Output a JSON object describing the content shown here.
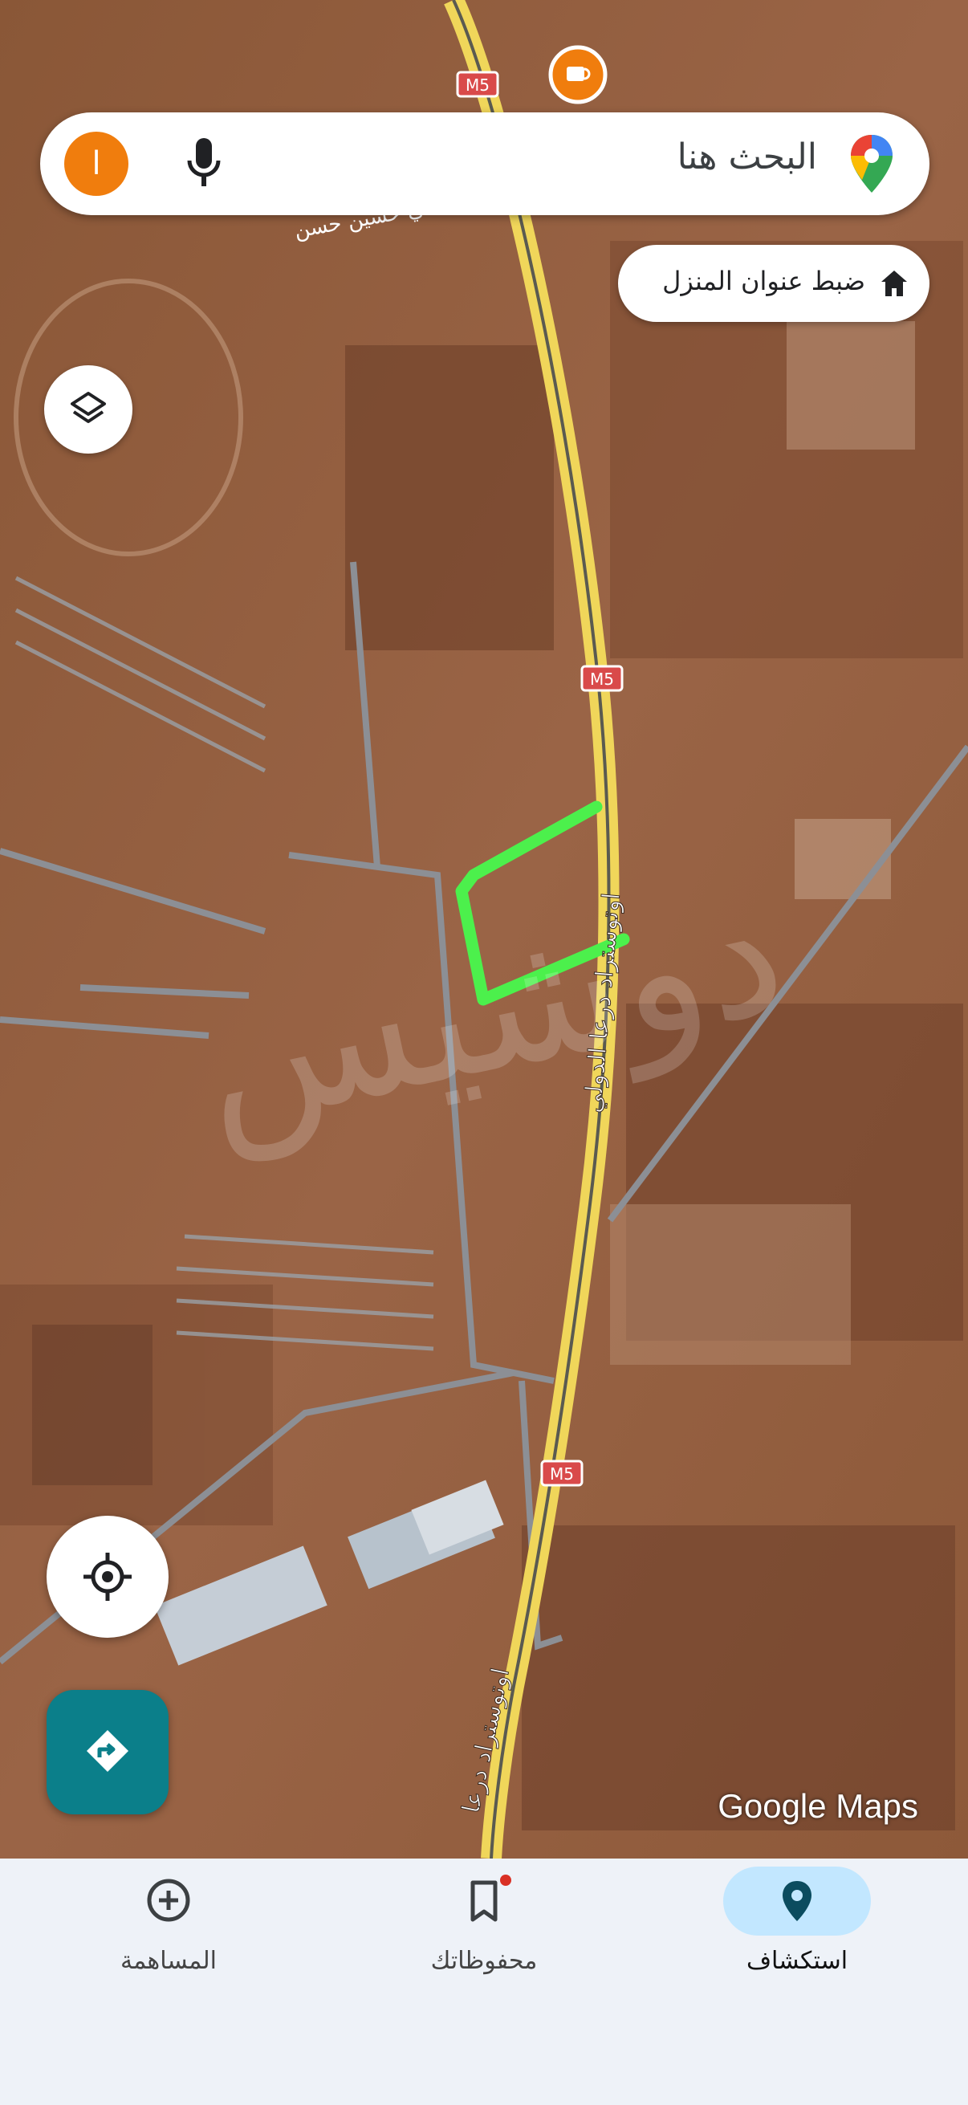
{
  "map": {
    "road_shields": [
      "M5",
      "M5",
      "M5"
    ],
    "road_labels": [
      "اوتوستراد درعا الدولي",
      "اوتوستراد درعا",
      "سي حسين حسن"
    ],
    "watermark_text": "دوشيس",
    "brand": "Google Maps",
    "highlight_color": "#4cf04c"
  },
  "search": {
    "placeholder": "البحث هنا",
    "avatar_letter": "ا",
    "avatar_color": "#f07d0d"
  },
  "chips": {
    "home": "ضبط عنوان المنزل"
  },
  "buttons": {
    "layers_icon": "layers-icon",
    "locate_icon": "my-location-icon",
    "directions_icon": "directions-icon"
  },
  "nav": {
    "items": [
      {
        "label": "استكشاف",
        "icon": "location-pin-icon",
        "active": true
      },
      {
        "label": "محفوظاتك",
        "icon": "bookmark-icon",
        "active": false
      },
      {
        "label": "المساهمة",
        "icon": "add-circle-icon",
        "active": false
      }
    ],
    "active_color": "#c2e7ff"
  }
}
